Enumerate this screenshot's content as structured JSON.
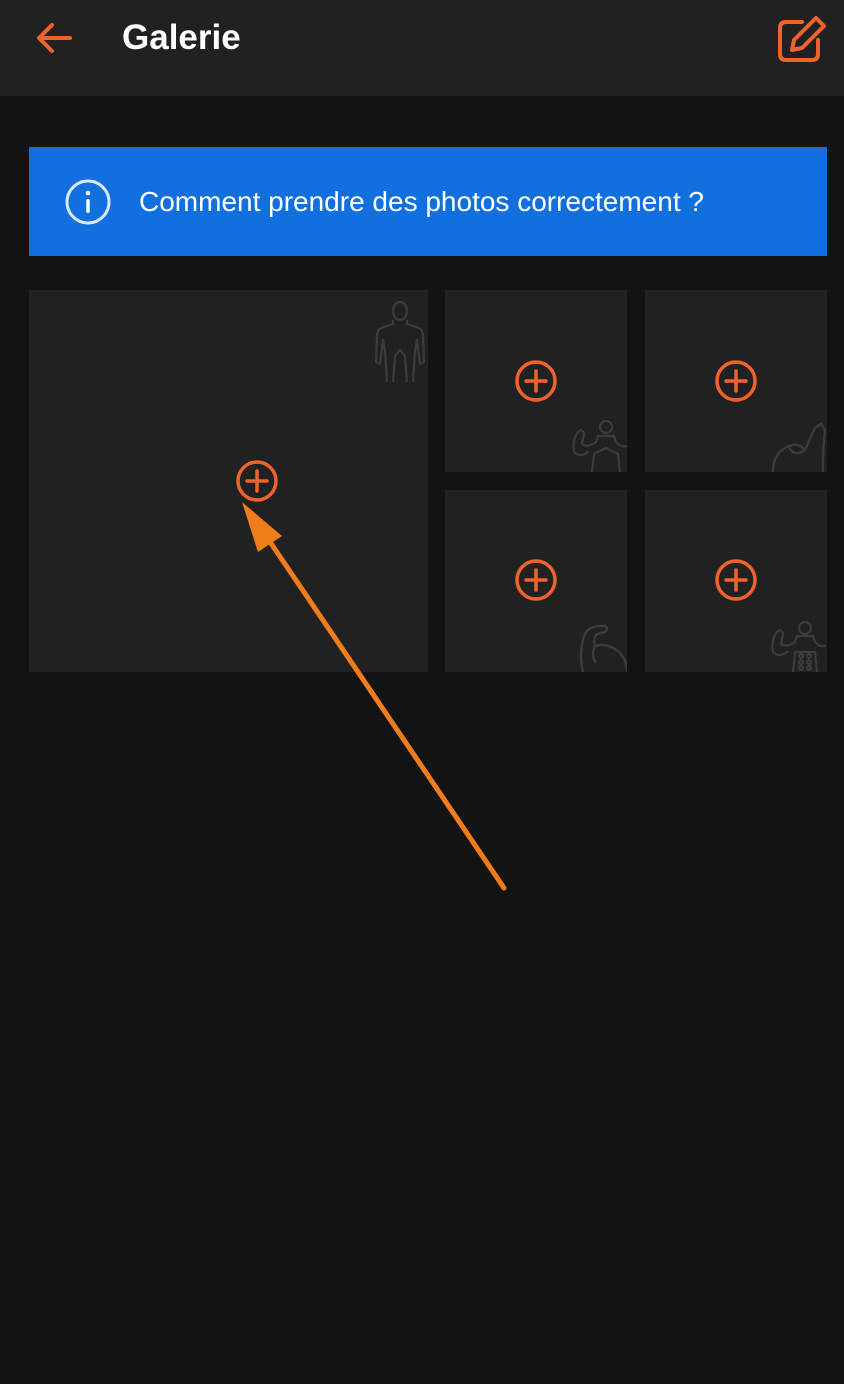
{
  "header": {
    "title": "Galerie",
    "back_icon": "arrow-left-icon",
    "edit_icon": "edit-square-icon"
  },
  "banner": {
    "text": "Comment prendre des photos correctement ?",
    "icon": "info-circle-icon"
  },
  "tiles": [
    {
      "pose": "front-full-body",
      "icon": "plus-circle-icon"
    },
    {
      "pose": "back-double-biceps",
      "icon": "plus-circle-icon"
    },
    {
      "pose": "flexed-arm",
      "icon": "plus-circle-icon"
    },
    {
      "pose": "side-arm-flex",
      "icon": "plus-circle-icon"
    },
    {
      "pose": "front-double-biceps-abs",
      "icon": "plus-circle-icon"
    }
  ],
  "colors": {
    "accent": "#f2622b",
    "banner": "#1170dd",
    "header_bg": "#212121",
    "page_bg": "#131313",
    "tile_bg": "#212121",
    "annotation_arrow": "#f07c1a"
  }
}
